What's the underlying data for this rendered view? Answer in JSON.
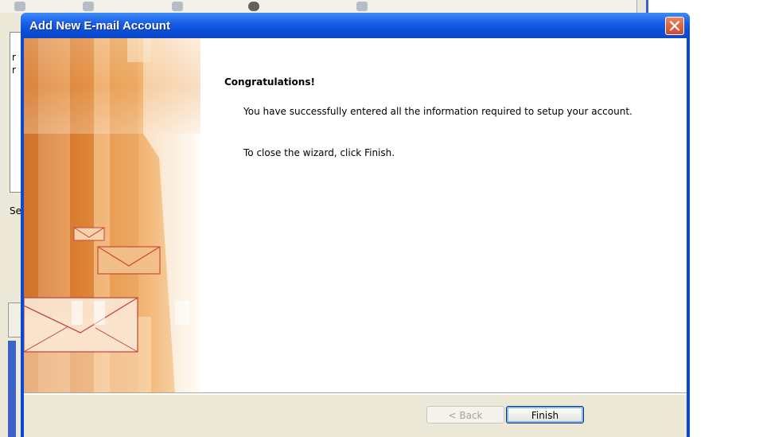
{
  "background": {
    "list_rows": [
      "r",
      "r"
    ],
    "label": "Se"
  },
  "dialog": {
    "title": "Add New E-mail Account",
    "close_label": "×",
    "heading": "Congratulations!",
    "message1": "You have successfully entered all the information required to setup your account.",
    "message2": "To close the wizard, click Finish.",
    "back_button": "< Back",
    "finish_button": "Finish"
  },
  "colors": {
    "titlebar": "#0a4fd9",
    "dialog_face": "#ece9d8",
    "art_orange": "#e08a3c",
    "envelope_line": "#c8463c"
  }
}
